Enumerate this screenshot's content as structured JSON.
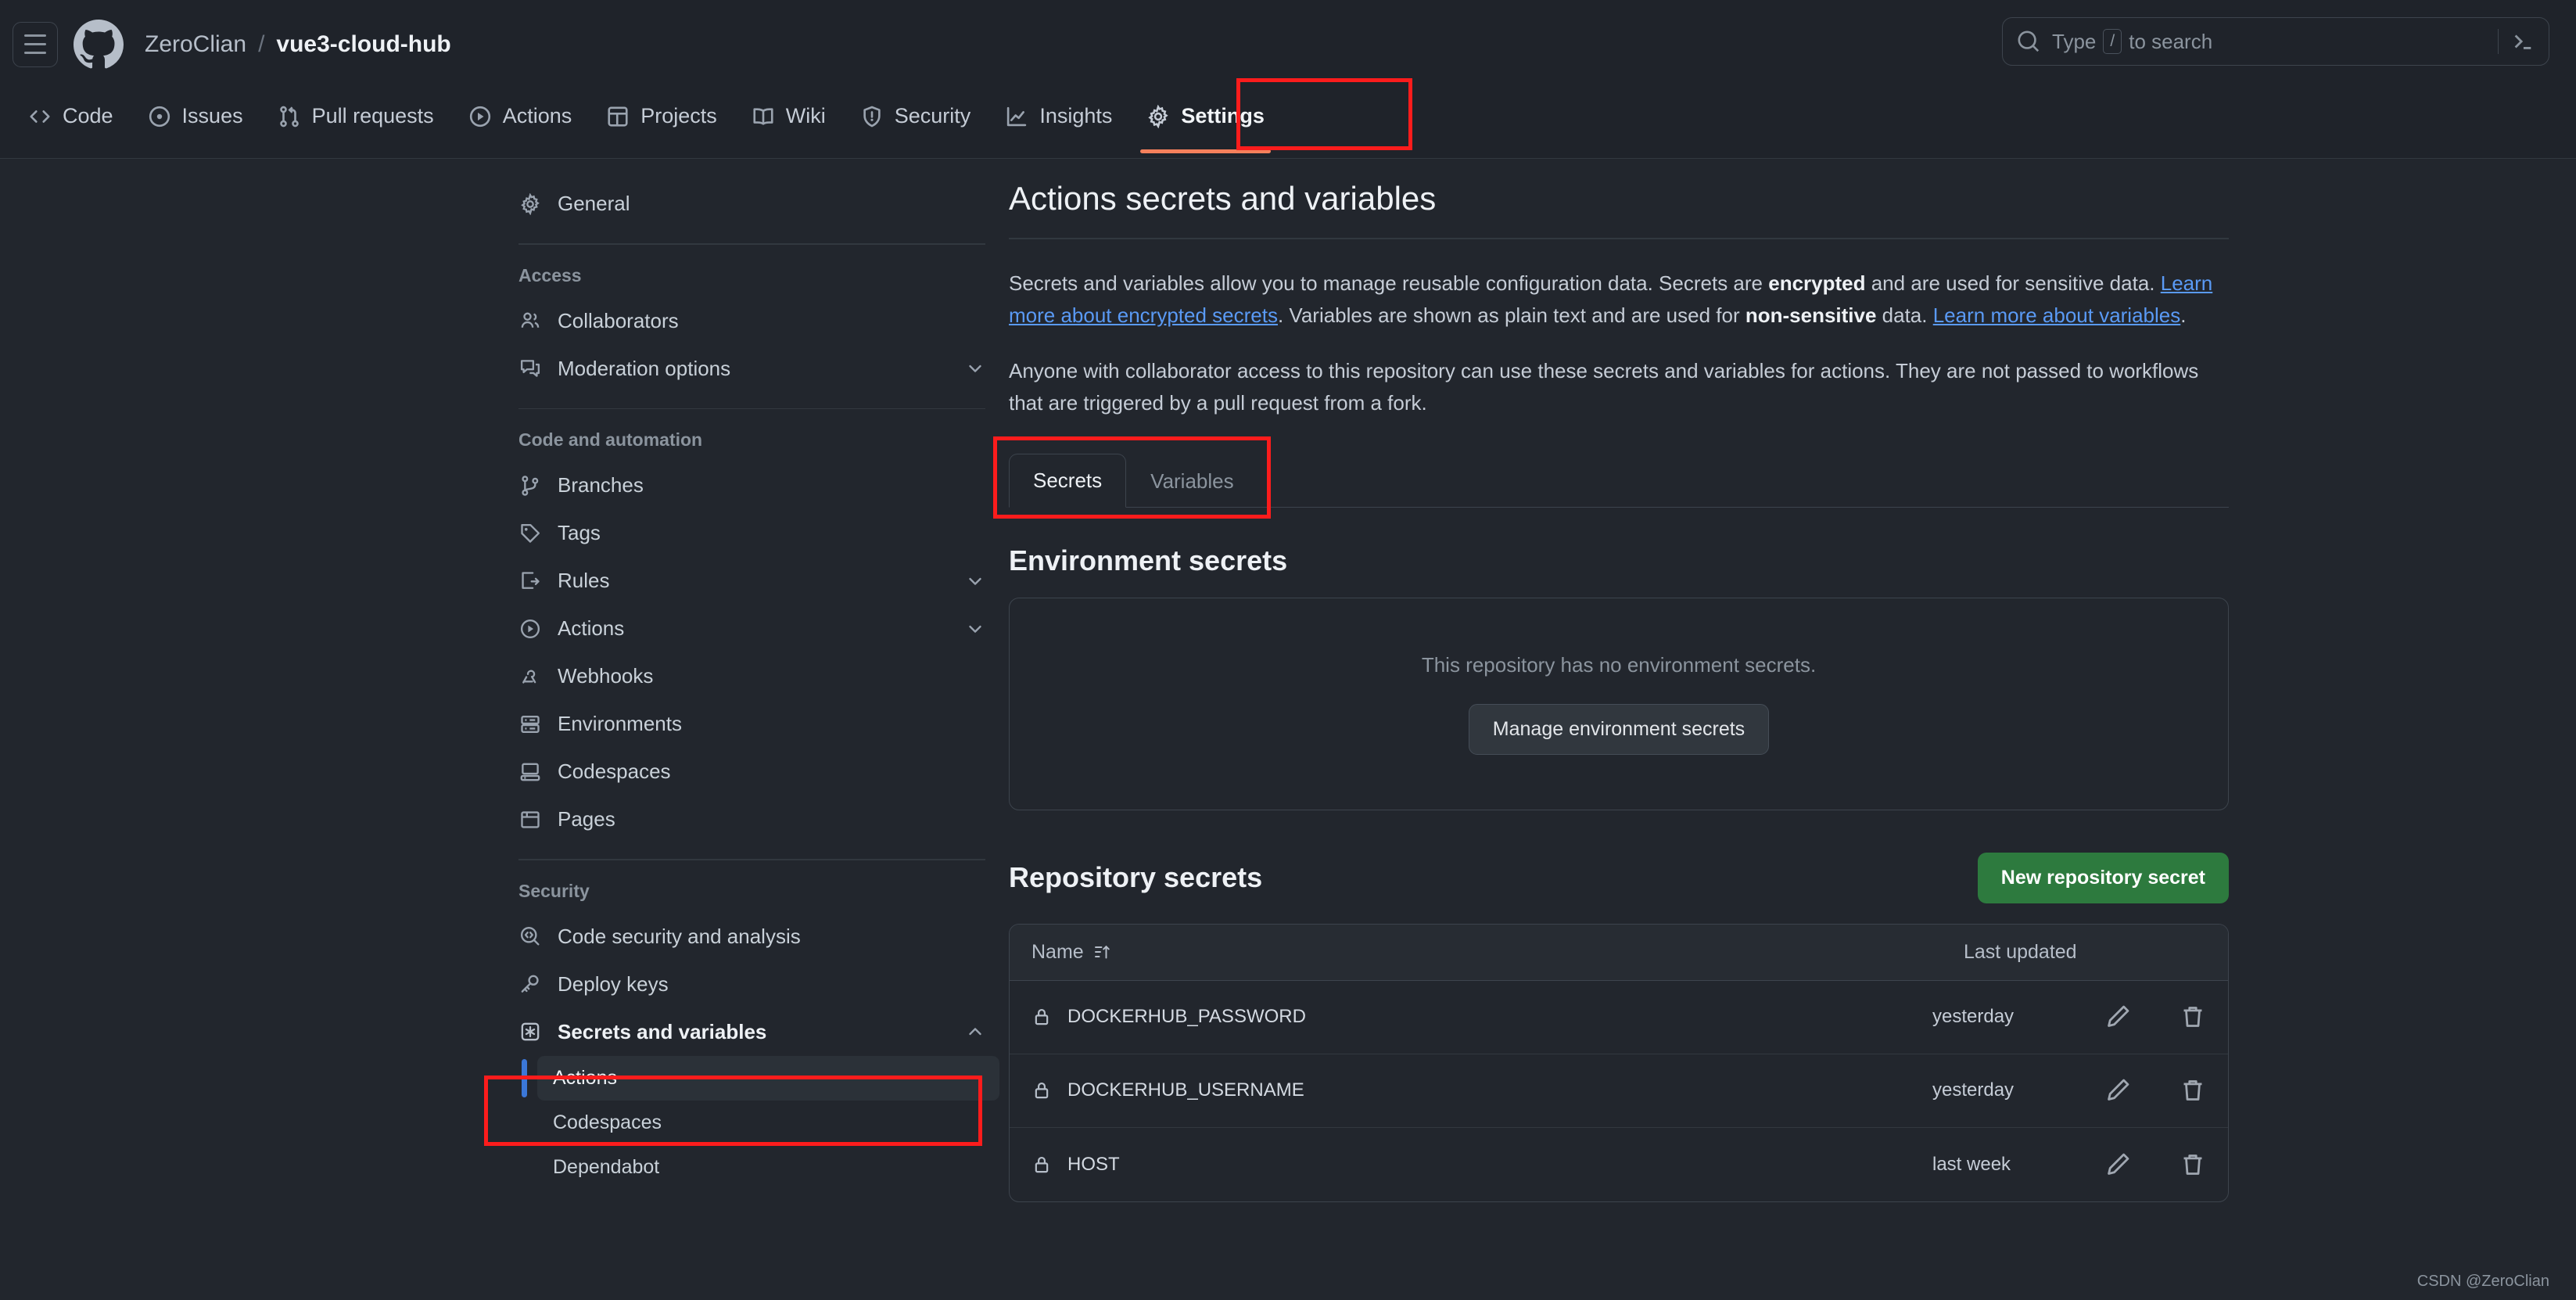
{
  "header": {
    "menu_icon": "hamburger-icon",
    "logo_icon": "github-logo-icon",
    "owner": "ZeroClian",
    "separator": "/",
    "repo": "vue3-cloud-hub",
    "search": {
      "icon": "search-icon",
      "placeholder_prefix": "Type",
      "placeholder_key": "/",
      "placeholder_suffix": "to search",
      "command_icon": "terminal-icon"
    }
  },
  "repo_nav": {
    "items": [
      {
        "label": "Code",
        "icon": "code-icon",
        "active": false
      },
      {
        "label": "Issues",
        "icon": "issue-opened-icon",
        "active": false
      },
      {
        "label": "Pull requests",
        "icon": "git-pull-request-icon",
        "active": false
      },
      {
        "label": "Actions",
        "icon": "play-icon",
        "active": false
      },
      {
        "label": "Projects",
        "icon": "project-board-icon",
        "active": false
      },
      {
        "label": "Wiki",
        "icon": "book-icon",
        "active": false
      },
      {
        "label": "Security",
        "icon": "shield-icon",
        "active": false
      },
      {
        "label": "Insights",
        "icon": "graph-icon",
        "active": false
      },
      {
        "label": "Settings",
        "icon": "gear-icon",
        "active": true
      }
    ]
  },
  "sidebar": {
    "general": {
      "label": "General",
      "icon": "gear-icon"
    },
    "groups": [
      {
        "title": "Access",
        "items": [
          {
            "label": "Collaborators",
            "icon": "people-icon",
            "chevron": false
          },
          {
            "label": "Moderation options",
            "icon": "comment-discussion-icon",
            "chevron": "down"
          }
        ]
      },
      {
        "title": "Code and automation",
        "items": [
          {
            "label": "Branches",
            "icon": "git-branch-icon",
            "chevron": false
          },
          {
            "label": "Tags",
            "icon": "tag-icon",
            "chevron": false
          },
          {
            "label": "Rules",
            "icon": "rules-icon",
            "chevron": "down"
          },
          {
            "label": "Actions",
            "icon": "play-icon",
            "chevron": "down"
          },
          {
            "label": "Webhooks",
            "icon": "webhook-icon",
            "chevron": false
          },
          {
            "label": "Environments",
            "icon": "server-icon",
            "chevron": false
          },
          {
            "label": "Codespaces",
            "icon": "codespaces-icon",
            "chevron": false
          },
          {
            "label": "Pages",
            "icon": "browser-icon",
            "chevron": false
          }
        ]
      },
      {
        "title": "Security",
        "items": [
          {
            "label": "Code security and analysis",
            "icon": "codescan-icon",
            "chevron": false
          },
          {
            "label": "Deploy keys",
            "icon": "key-icon",
            "chevron": false
          },
          {
            "label": "Secrets and variables",
            "icon": "asterisk-icon",
            "chevron": "up",
            "bold": true
          }
        ]
      }
    ],
    "secrets_subitems": [
      {
        "label": "Actions",
        "selected": true
      },
      {
        "label": "Codespaces",
        "selected": false
      },
      {
        "label": "Dependabot",
        "selected": false
      }
    ]
  },
  "main": {
    "title": "Actions secrets and variables",
    "paragraph1": {
      "part1": "Secrets and variables allow you to manage reusable configuration data. Secrets are ",
      "bold1": "encrypted",
      "part2": " and are used for sensitive data. ",
      "link1": "Learn more about encrypted secrets",
      "part3": ". Variables are shown as plain text and are used for ",
      "bold2": "non-sensitive",
      "part4": " data. ",
      "link2": "Learn more about variables",
      "part5": "."
    },
    "paragraph2": "Anyone with collaborator access to this repository can use these secrets and variables for actions. They are not passed to workflows that are triggered by a pull request from a fork.",
    "tabs": [
      {
        "label": "Secrets",
        "active": true
      },
      {
        "label": "Variables",
        "active": false
      }
    ],
    "environment_secrets": {
      "title": "Environment secrets",
      "empty_message": "This repository has no environment secrets.",
      "manage_button": "Manage environment secrets"
    },
    "repository_secrets": {
      "title": "Repository secrets",
      "new_button": "New repository secret",
      "columns": {
        "name": "Name",
        "sort_icon": "sort-asc-icon",
        "last_updated": "Last updated"
      },
      "rows": [
        {
          "icon": "lock-icon",
          "name": "DOCKERHUB_PASSWORD",
          "last_updated": "yesterday",
          "edit_icon": "pencil-icon",
          "delete_icon": "trash-icon"
        },
        {
          "icon": "lock-icon",
          "name": "DOCKERHUB_USERNAME",
          "last_updated": "yesterday",
          "edit_icon": "pencil-icon",
          "delete_icon": "trash-icon"
        },
        {
          "icon": "lock-icon",
          "name": "HOST",
          "last_updated": "last week",
          "edit_icon": "pencil-icon",
          "delete_icon": "trash-icon"
        }
      ]
    }
  },
  "watermark": "CSDN @ZeroClian",
  "colors": {
    "background": "#22262d",
    "header_background": "#1f232a",
    "border": "#3d444d",
    "text_primary": "#eef1f5",
    "text_muted": "#8b949e",
    "link": "#5a9af5",
    "accent_green": "#2d7a3e",
    "accent_orange": "#f4805c",
    "accent_blue": "#3b77d8",
    "annotation_red": "#fc1c1c"
  }
}
